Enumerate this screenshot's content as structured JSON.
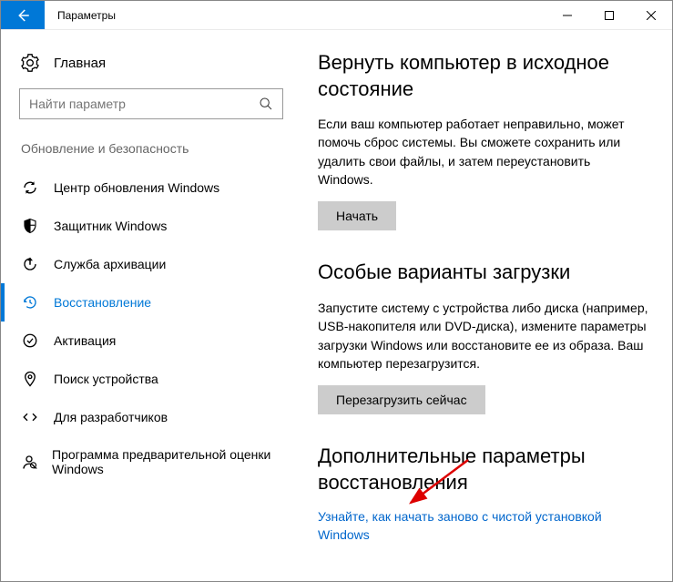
{
  "titlebar": {
    "title": "Параметры"
  },
  "sidebar": {
    "home_label": "Главная",
    "search_placeholder": "Найти параметр",
    "category": "Обновление и безопасность",
    "items": [
      {
        "label": "Центр обновления Windows"
      },
      {
        "label": "Защитник Windows"
      },
      {
        "label": "Служба архивации"
      },
      {
        "label": "Восстановление"
      },
      {
        "label": "Активация"
      },
      {
        "label": "Поиск устройства"
      },
      {
        "label": "Для разработчиков"
      },
      {
        "label": "Программа предварительной оценки Windows"
      }
    ]
  },
  "content": {
    "reset": {
      "heading": "Вернуть компьютер в исходное состояние",
      "body": "Если ваш компьютер работает неправильно, может помочь сброс системы. Вы сможете сохранить или удалить свои файлы, и затем переустановить Windows.",
      "button": "Начать"
    },
    "advanced_startup": {
      "heading": "Особые варианты загрузки",
      "body": "Запустите систему с устройства либо диска (например, USB-накопителя или DVD-диска), измените параметры загрузки Windows или восстановите ее из образа. Ваш компьютер перезагрузится.",
      "button": "Перезагрузить сейчас"
    },
    "more_recovery": {
      "heading": "Дополнительные параметры восстановления",
      "link": "Узнайте, как начать заново с чистой установкой Windows"
    }
  }
}
